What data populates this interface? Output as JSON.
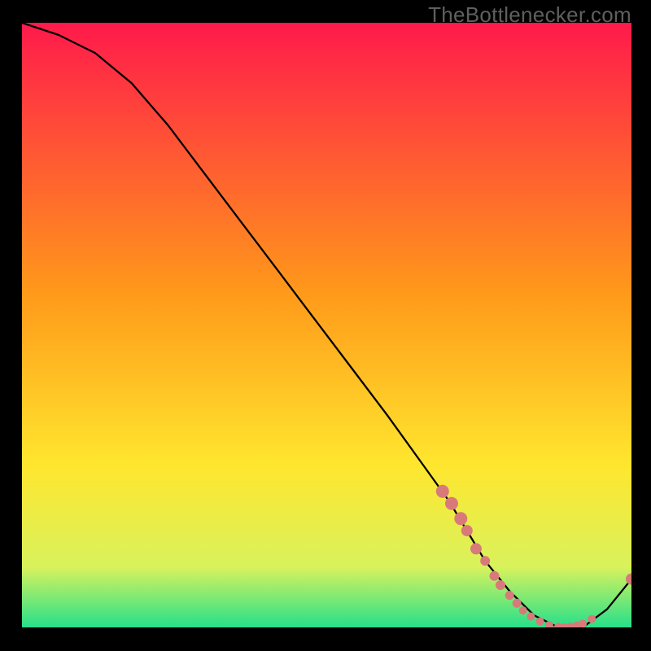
{
  "watermark": "TheBottlenecker.com",
  "colors": {
    "red": "#ff1a4b",
    "orange": "#ff9a1a",
    "yellow": "#ffe62e",
    "ygreen": "#d9f25c",
    "green": "#26e08a",
    "black": "#000000",
    "stroke": "#000000",
    "marker_fill": "#d97a7a",
    "marker_stroke": "#7a2e2e"
  },
  "chart_data": {
    "type": "line",
    "title": "",
    "xlabel": "",
    "ylabel": "",
    "xlim": [
      0,
      100
    ],
    "ylim": [
      0,
      100
    ],
    "series": [
      {
        "name": "curve",
        "x": [
          0,
          6,
          12,
          18,
          24,
          30,
          36,
          42,
          48,
          54,
          60,
          65,
          70,
          73,
          76,
          80,
          84,
          88,
          92,
          96,
          100
        ],
        "y": [
          100,
          98,
          95,
          90,
          83,
          75,
          67,
          59,
          51,
          43,
          35,
          28,
          21,
          16,
          11,
          6,
          2,
          0,
          0,
          3,
          8
        ]
      }
    ],
    "markers": [
      {
        "x": 69.0,
        "y": 22.5,
        "r": 8
      },
      {
        "x": 70.5,
        "y": 20.5,
        "r": 8
      },
      {
        "x": 72.0,
        "y": 18.0,
        "r": 8
      },
      {
        "x": 73.0,
        "y": 16.0,
        "r": 7
      },
      {
        "x": 74.5,
        "y": 13.0,
        "r": 7
      },
      {
        "x": 76.0,
        "y": 11.0,
        "r": 6
      },
      {
        "x": 77.5,
        "y": 8.5,
        "r": 6
      },
      {
        "x": 78.5,
        "y": 7.0,
        "r": 6
      },
      {
        "x": 80.0,
        "y": 5.3,
        "r": 5.5
      },
      {
        "x": 81.2,
        "y": 4.0,
        "r": 5.5
      },
      {
        "x": 82.2,
        "y": 2.8,
        "r": 5
      },
      {
        "x": 83.5,
        "y": 1.8,
        "r": 5
      },
      {
        "x": 85.0,
        "y": 1.0,
        "r": 5
      },
      {
        "x": 86.5,
        "y": 0.4,
        "r": 5
      },
      {
        "x": 88.0,
        "y": 0.1,
        "r": 5
      },
      {
        "x": 89.0,
        "y": 0.0,
        "r": 5
      },
      {
        "x": 90.0,
        "y": 0.1,
        "r": 5
      },
      {
        "x": 91.0,
        "y": 0.3,
        "r": 5
      },
      {
        "x": 92.0,
        "y": 0.6,
        "r": 5
      },
      {
        "x": 93.5,
        "y": 1.4,
        "r": 5
      },
      {
        "x": 100.0,
        "y": 8.0,
        "r": 7
      }
    ],
    "marker_label": {
      "text": "",
      "x": 86,
      "y": 1.5
    }
  }
}
